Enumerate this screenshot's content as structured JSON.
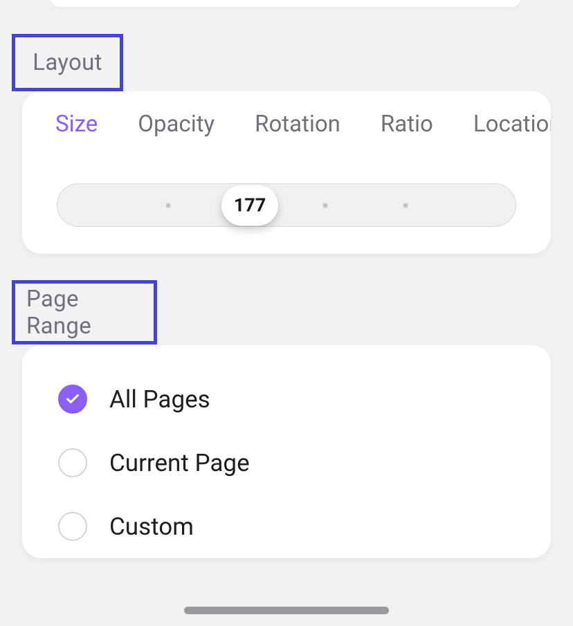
{
  "sections": {
    "layout": {
      "heading": "Layout",
      "tabs": [
        "Size",
        "Opacity",
        "Rotation",
        "Ratio",
        "Location"
      ],
      "active_tab_index": 0,
      "slider": {
        "value": 177,
        "dots_pct": [
          24.2,
          58.5,
          76.0
        ],
        "thumb_pct": 42.0
      }
    },
    "page_range": {
      "heading": "Page Range",
      "options": [
        {
          "label": "All Pages",
          "selected": true
        },
        {
          "label": "Current Page",
          "selected": false
        },
        {
          "label": "Custom",
          "selected": false
        }
      ]
    }
  },
  "colors": {
    "accent": "#895ff5",
    "highlight_border": "#4343d6",
    "bg": "#f2f2f4",
    "card": "#ffffff",
    "text_muted": "#70707a",
    "text": "#1e1e1e"
  }
}
